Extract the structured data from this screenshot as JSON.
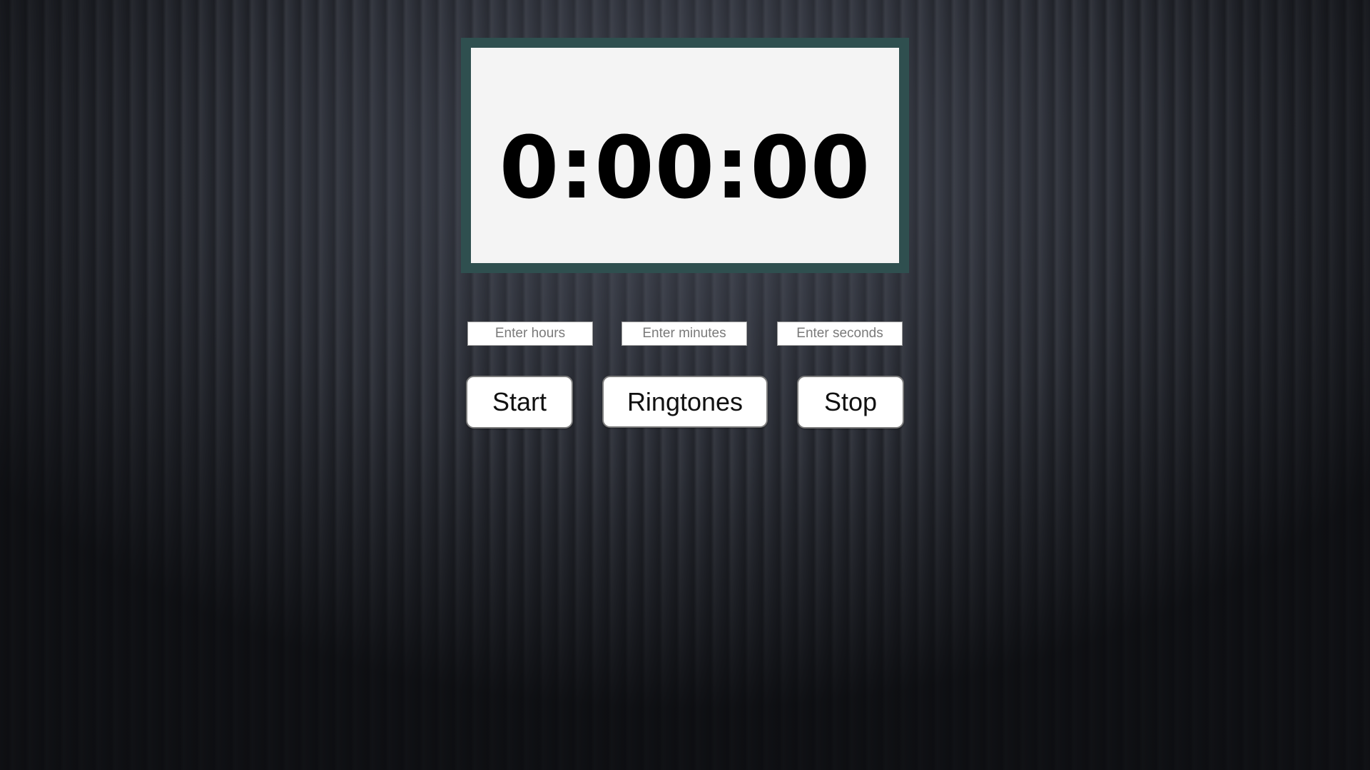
{
  "timer": {
    "display": "0:00:00"
  },
  "inputs": {
    "hours": {
      "placeholder": "Enter hours",
      "value": ""
    },
    "minutes": {
      "placeholder": "Enter minutes",
      "value": ""
    },
    "seconds": {
      "placeholder": "Enter seconds",
      "value": ""
    }
  },
  "buttons": {
    "start": "Start",
    "ringtones": "Ringtones",
    "stop": "Stop"
  },
  "colors": {
    "frame": "#2f4f4f",
    "display_bg": "#f4f4f4",
    "page_bg": "#2b2e36"
  }
}
